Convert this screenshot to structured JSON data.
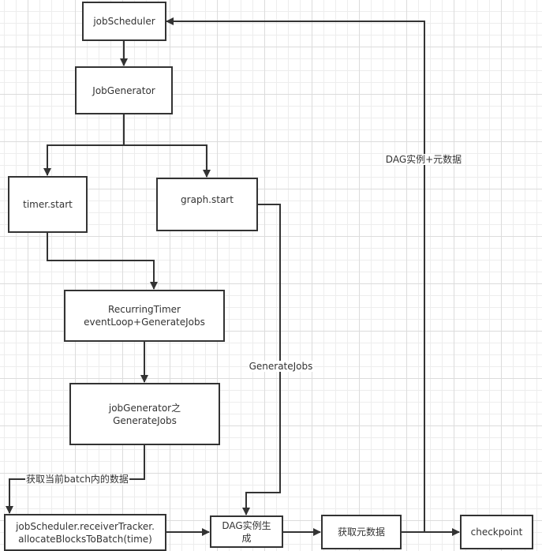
{
  "diagram": {
    "type": "flowchart",
    "nodes": {
      "jobScheduler": "jobScheduler",
      "jobGenerator": "JobGenerator",
      "timerStart": "timer.start",
      "graphStart": "graph.start",
      "recurringTimer": "RecurringTimer\neventLoop+GenerateJobs",
      "jobGeneratorGenerateJobs": "jobGenerator之\nGenerateJobs",
      "allocateBlocks": "jobScheduler.receiverTracker.\nallocateBlocksToBatch(time)",
      "dagGenerate": "DAG实例生\n成",
      "getMetadata": "获取元数据",
      "checkpoint": "checkpoint"
    },
    "edge_labels": {
      "dagPlusMetadata": "DAG实例+元数据",
      "generateJobs": "GenerateJobs",
      "fetchBatchData": "获取当前batch内的数据"
    },
    "edges": [
      {
        "from": "jobScheduler",
        "to": "jobGenerator",
        "label": ""
      },
      {
        "from": "jobGenerator",
        "to": "timerStart",
        "label": ""
      },
      {
        "from": "jobGenerator",
        "to": "graphStart",
        "label": ""
      },
      {
        "from": "timerStart",
        "to": "recurringTimer",
        "label": ""
      },
      {
        "from": "recurringTimer",
        "to": "jobGeneratorGenerateJobs",
        "label": ""
      },
      {
        "from": "jobGeneratorGenerateJobs",
        "to": "allocateBlocks",
        "label": "获取当前batch内的数据"
      },
      {
        "from": "graphStart",
        "to": "dagGenerate",
        "label": "GenerateJobs"
      },
      {
        "from": "allocateBlocks",
        "to": "dagGenerate",
        "label": ""
      },
      {
        "from": "dagGenerate",
        "to": "getMetadata",
        "label": ""
      },
      {
        "from": "getMetadata",
        "to": "checkpoint",
        "label": ""
      },
      {
        "from": "getMetadata",
        "to": "jobScheduler",
        "label": "DAG实例+元数据"
      }
    ],
    "colors": {
      "stroke": "#333333",
      "grid_minor": "#ededed",
      "grid_major": "#dcdcdc",
      "background": "#ffffff"
    }
  }
}
